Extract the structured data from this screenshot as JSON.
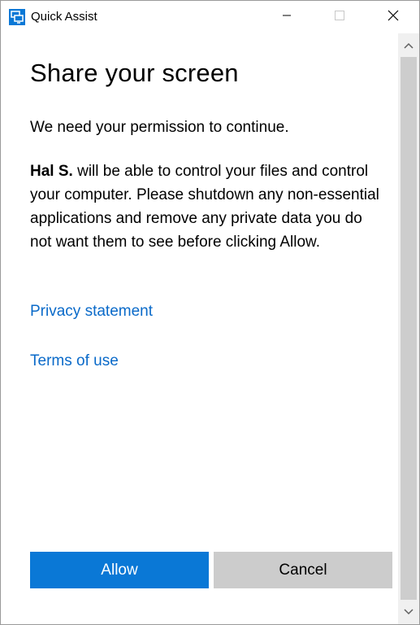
{
  "window": {
    "title": "Quick Assist",
    "app_icon": "quick-assist-icon",
    "controls": {
      "minimize_icon": "minimize-icon",
      "maximize_icon": "maximize-icon",
      "close_icon": "close-icon"
    }
  },
  "content": {
    "heading": "Share your screen",
    "intro": "We need your permission to continue.",
    "body": {
      "bold_name": "Hal S.",
      "text": " will be able to control your files and control your computer. Please shutdown any non-essential applications and remove any private data you do not want them to see before clicking Allow."
    },
    "links": {
      "privacy": "Privacy statement",
      "terms": "Terms of use"
    }
  },
  "actions": {
    "allow_label": "Allow",
    "cancel_label": "Cancel"
  },
  "colors": {
    "accent": "#0a78d6",
    "link": "#0a6ac9",
    "secondary_button": "#cccccc",
    "scrollbar_track": "#f0f0f0",
    "scrollbar_thumb": "#cdcdcd"
  }
}
